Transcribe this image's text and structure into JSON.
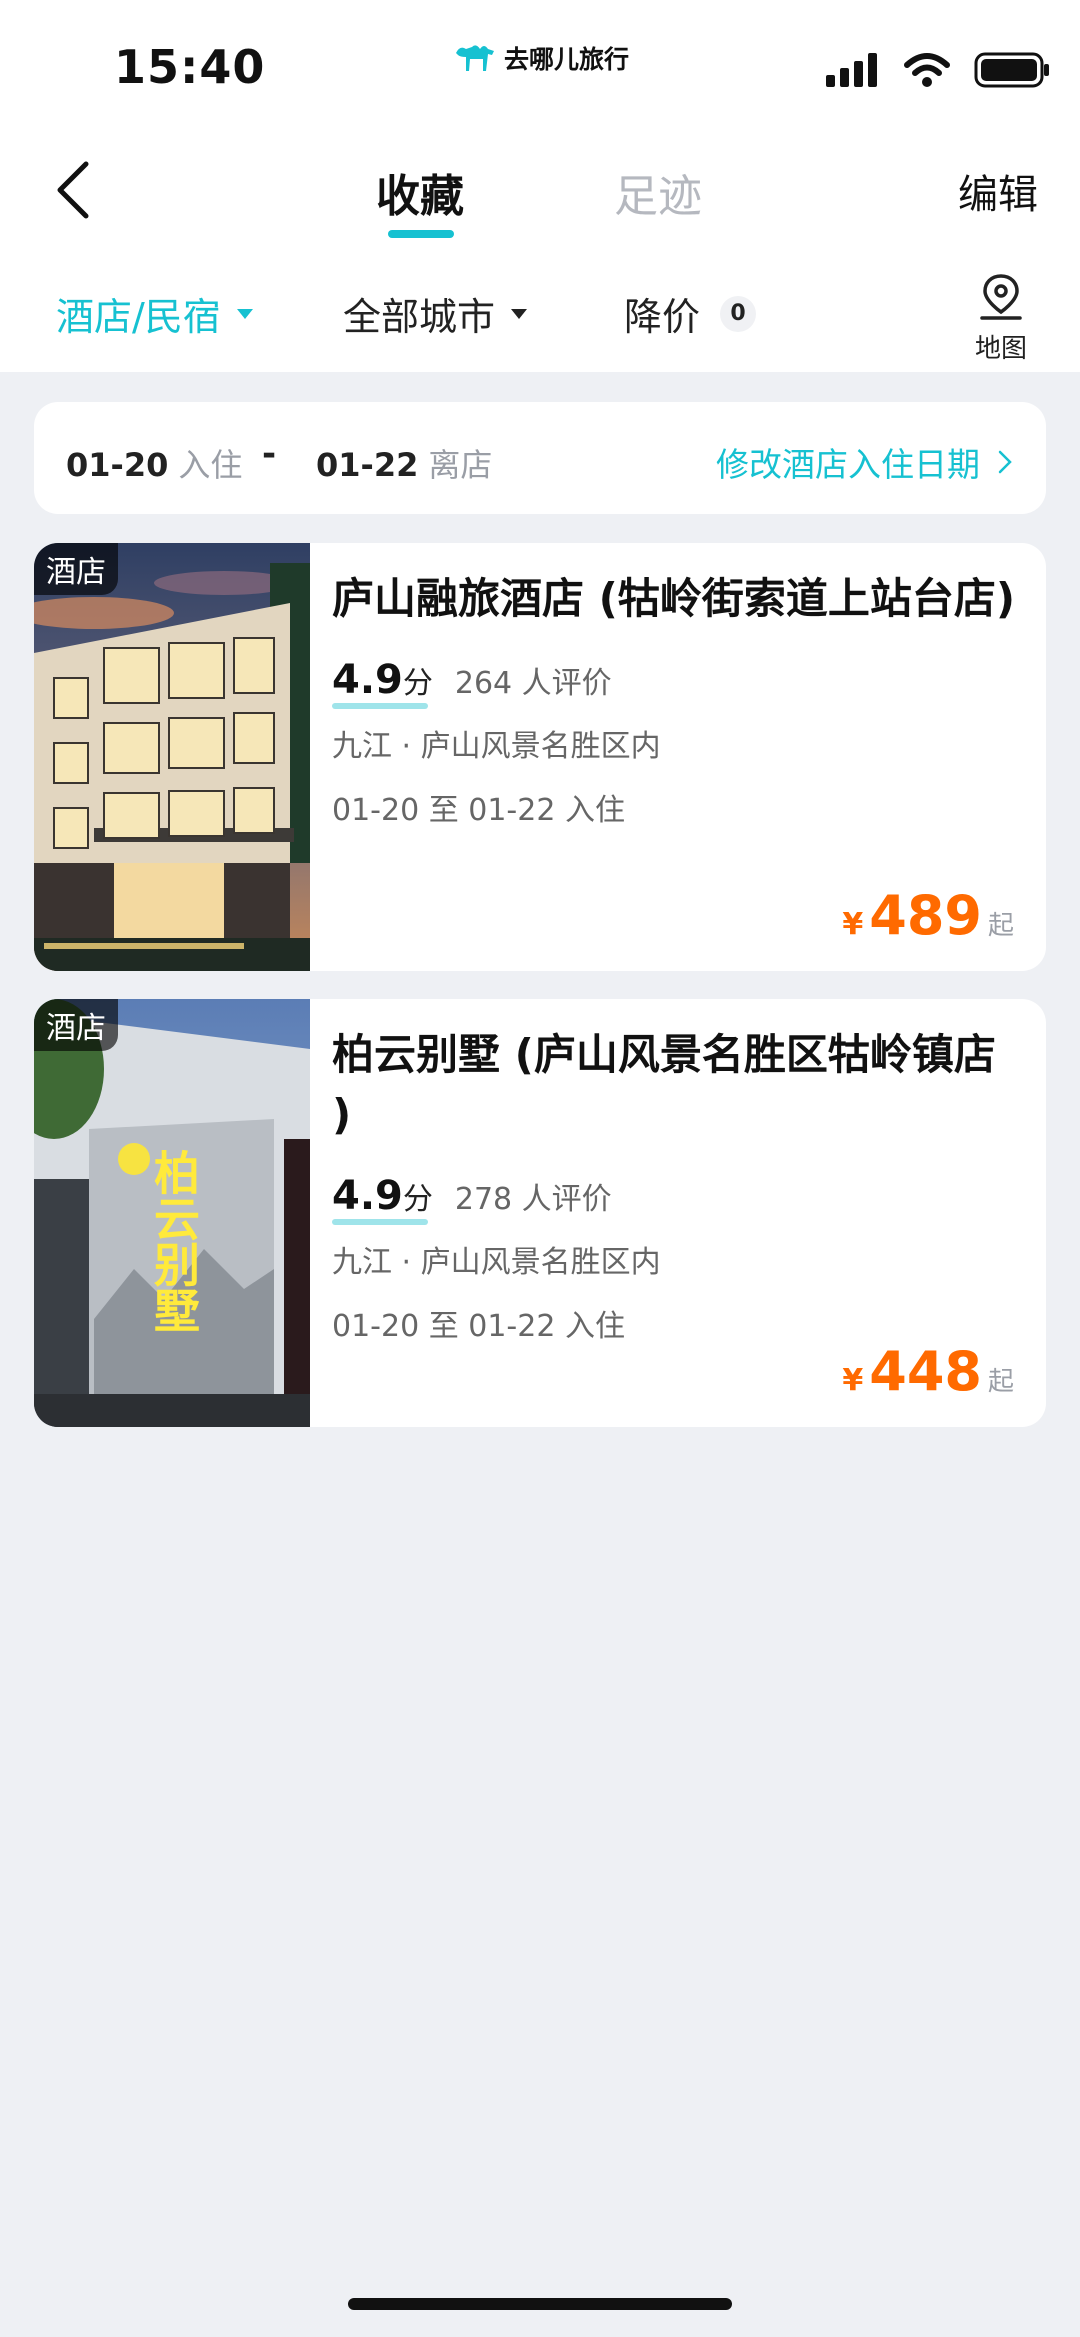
{
  "status_bar": {
    "time": "15:40",
    "brand": "去哪儿旅行"
  },
  "nav": {
    "tabs": [
      {
        "label": "收藏",
        "active": true
      },
      {
        "label": "足迹",
        "active": false
      }
    ],
    "edit_label": "编辑"
  },
  "filters": {
    "type": "酒店/民宿",
    "city": "全部城市",
    "price_drop": "降价",
    "price_drop_count": "0",
    "map_label": "地图"
  },
  "date_bar": {
    "checkin_date": "01-20",
    "checkin_label": "入住",
    "dash": "-",
    "checkout_date": "01-22",
    "checkout_label": "离店",
    "modify_label": "修改酒店入住日期"
  },
  "hotels": [
    {
      "tag": "酒店",
      "name": "庐山融旅酒店 (牯岭街索道上站台店)",
      "score": "4.9",
      "score_unit": "分",
      "reviews": "264 人评价",
      "location": "九江 · 庐山风景名胜区内",
      "dates": "01-20 至 01-22 入住",
      "currency": "¥",
      "price": "489",
      "price_suffix": "起"
    },
    {
      "tag": "酒店",
      "name": "柏云别墅 (庐山风景名胜区牯岭镇店 )",
      "score": "4.9",
      "score_unit": "分",
      "reviews": "278 人评价",
      "location": "九江 · 庐山风景名胜区内",
      "dates": "01-20 至 01-22 入住",
      "currency": "¥",
      "price": "448",
      "price_suffix": "起",
      "sign_text": "柏云别墅"
    }
  ],
  "colors": {
    "accent": "#16c1d1",
    "price": "#ff6a00",
    "background": "#eef0f4"
  }
}
